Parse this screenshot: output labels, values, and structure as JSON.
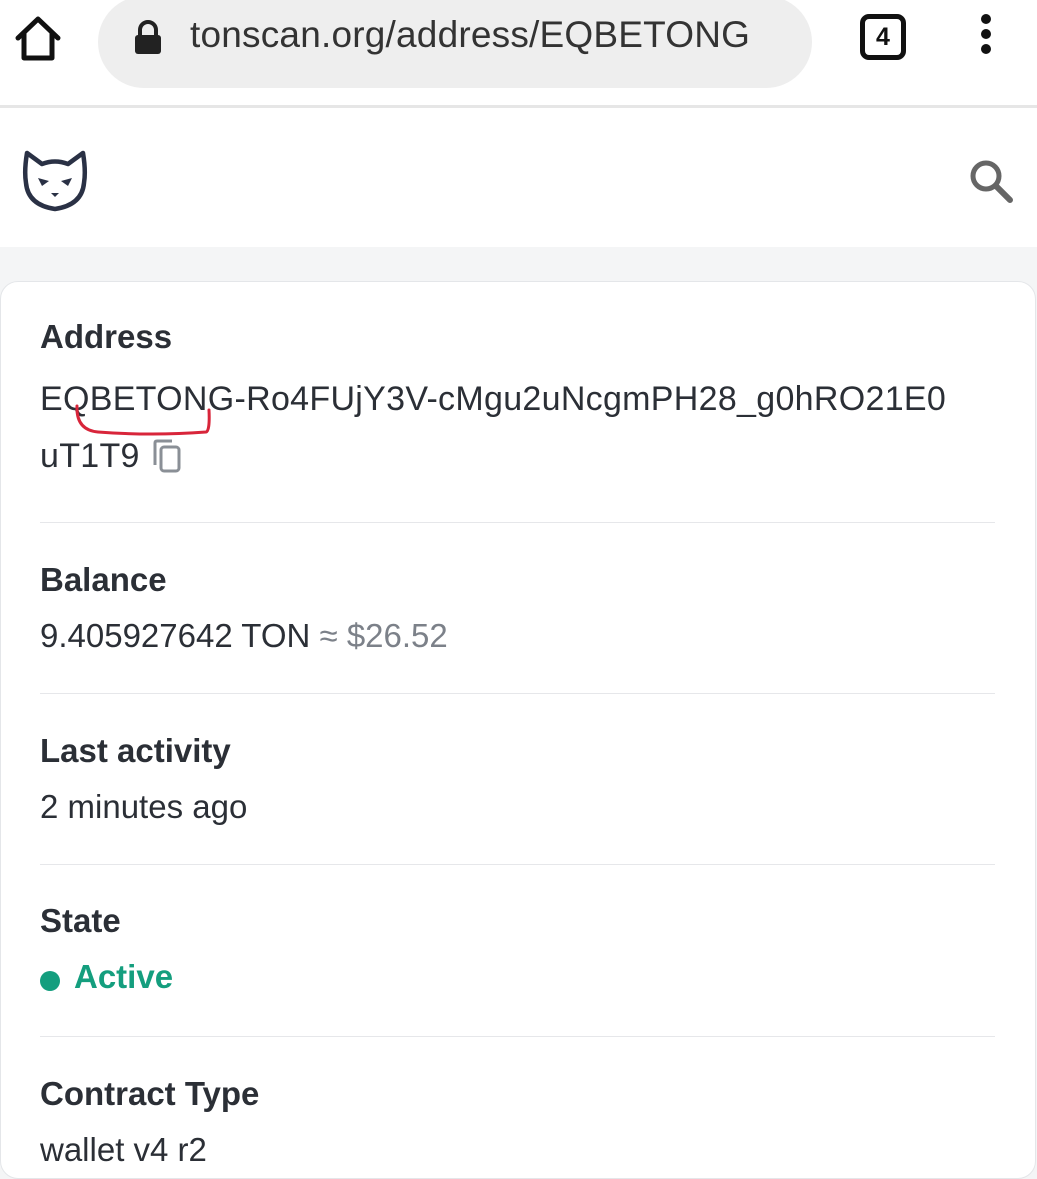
{
  "browser": {
    "url": "tonscan.org/address/EQBETONG",
    "tab_count": "4"
  },
  "address": {
    "label": "Address",
    "line1": "EQBETONG-Ro4FUjY3V-cMgu2uNcgmPH28_g0hRO21E0",
    "line2": "uT1T9"
  },
  "balance": {
    "label": "Balance",
    "amount": "9.405927642 TON",
    "approx": "≈",
    "usd": "$26.52"
  },
  "last_activity": {
    "label": "Last activity",
    "value": "2 minutes ago"
  },
  "state": {
    "label": "State",
    "value": "Active",
    "color": "#149e7e"
  },
  "contract_type": {
    "label": "Contract Type",
    "value": "wallet v4 r2"
  }
}
